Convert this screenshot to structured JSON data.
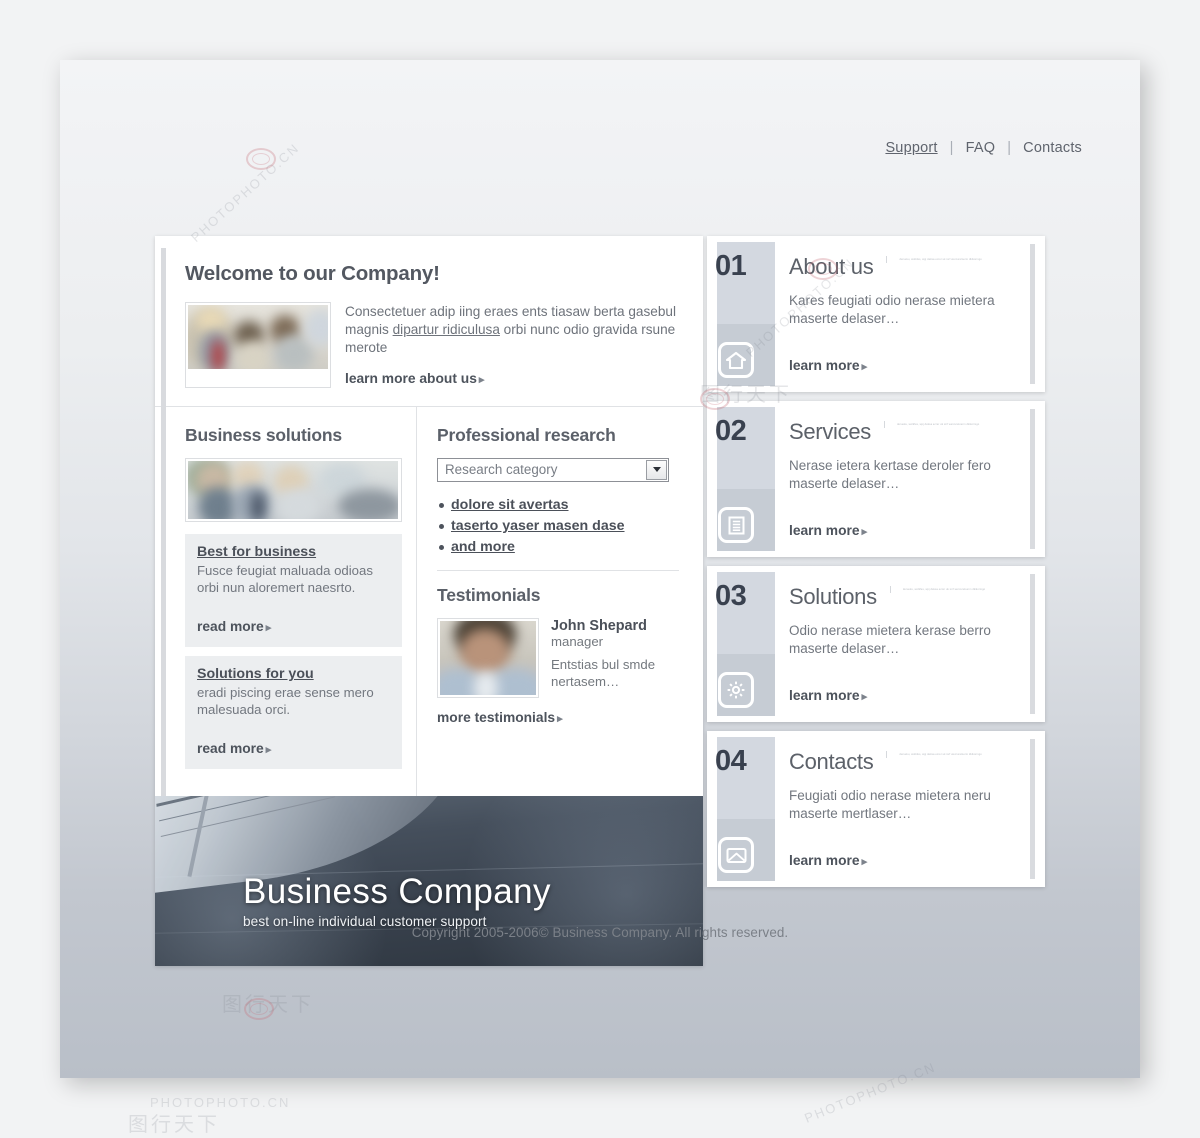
{
  "topnav": {
    "items": [
      {
        "label": "Support",
        "active": true
      },
      {
        "label": "FAQ",
        "active": false
      },
      {
        "label": "Contacts",
        "active": false
      }
    ],
    "separator": "|"
  },
  "welcome": {
    "heading": "Welcome to our Company!",
    "image_alt": "team-photo",
    "text_before": "Consectetuer adip iing eraes ents tiasaw berta gasebul magnis ",
    "link_inline": "dipartur ridiculusa",
    "text_after": " orbi nunc odio gravida rsune merote",
    "cta": "learn more about us",
    "cta_arrow": "▸"
  },
  "business_solutions": {
    "heading": "Business solutions",
    "image_alt": "business-people-photo",
    "tiles": [
      {
        "title": "Best for business",
        "text": "Fusce feugiat maluada odioas orbi nun aloremert naesrto.",
        "cta": "read more"
      },
      {
        "title": "Solutions for you",
        "text": "eradi piscing erae sense mero malesuada orci.",
        "cta": "read more"
      }
    ],
    "cta_arrow": "▸"
  },
  "professional_research": {
    "heading": "Professional research",
    "select": {
      "value": "Research category",
      "placeholder": "Research category",
      "options": [
        "Research category"
      ]
    },
    "links": [
      "dolore sit avertas",
      "taserto yaser masen dase",
      "and more"
    ]
  },
  "testimonials": {
    "heading": "Testimonials",
    "avatar_alt": "john-shepard-avatar",
    "name": "John Shepard",
    "role": "manager",
    "quote": "Entstias bul smde nertasem…",
    "cta": "more testimonials",
    "cta_arrow": "▸"
  },
  "banner": {
    "title": "Business Company",
    "subtitle": "best on-line individual customer support"
  },
  "cards": [
    {
      "number": "01",
      "title": "About us",
      "icon": "home-icon",
      "micro": "derueku, wolkfes, wpj deksa ecrer uk iorf wercureloerm dkikormgo",
      "desc": "Kares feugiati odio nerase mietera maserte delaser…",
      "cta": "learn more",
      "cta_arrow": "▸"
    },
    {
      "number": "02",
      "title": "Services",
      "icon": "document-icon",
      "micro": "derueku, wolkfes, wpj deksa ecrer uk iorf wercureloerm dkikormgo",
      "desc": "Nerase ietera kertase deroler fero maserte delaser…",
      "cta": "learn more",
      "cta_arrow": "▸"
    },
    {
      "number": "03",
      "title": "Solutions",
      "icon": "gear-icon",
      "micro": "derueku, wolkfes, wpj deksa ecrer uk iorf wercureloerm dkikormgo",
      "desc": "Odio nerase mietera kerase berro maserte delaser…",
      "cta": "learn more",
      "cta_arrow": "▸"
    },
    {
      "number": "04",
      "title": "Contacts",
      "icon": "envelope-icon",
      "micro": "derueku, wolkfes, wpj deksa ecrer uk iorf wercureloerm dkikormgo",
      "desc": "Feugiati odio nerase mietera neru maserte mertlaser…",
      "cta": "learn more",
      "cta_arrow": "▸"
    }
  ],
  "footer": {
    "copyright": "Copyright 2005-2006© Business Company. All rights reserved."
  },
  "watermarks": {
    "latin": "PHOTOPHOTO.CN",
    "cjk": "图行天下"
  },
  "colors": {
    "page_bg": "#f2f3f4",
    "canvas_top": "#f3f4f6",
    "canvas_bottom": "#b9bfc8",
    "panel_bg": "#ffffff",
    "tile_bg": "#eceef0",
    "heading": "#5b6069",
    "body_text": "#72777f",
    "link_strong": "#4b5059",
    "card_rail": "#d3d8e0",
    "card_rail_lower": "#c6ccd4",
    "card_number": "#39414f",
    "banner_dark": "#2f3741"
  }
}
